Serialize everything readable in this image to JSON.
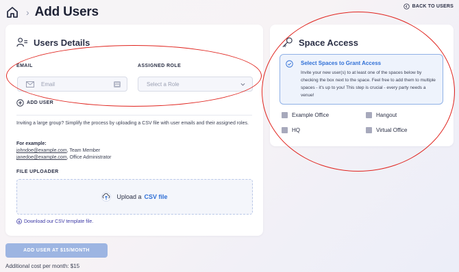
{
  "header": {
    "title": "Add Users",
    "back_label": "BACK TO USERS"
  },
  "users_card": {
    "title": "Users Details",
    "email_label": "EMAIL",
    "email_placeholder": "Email",
    "role_label": "ASSIGNED ROLE",
    "role_placeholder": "Select a Role",
    "add_user_label": "ADD USER",
    "bulk_text": "Inviting a large group? Simplify the process by uploading a CSV file with user emails and their assigned roles.",
    "example_title": "For example:",
    "examples": [
      {
        "email": "johndoe@example.com",
        "role": ", Team Member"
      },
      {
        "email": "janedoe@example.com",
        "role": ", Office Administrator"
      }
    ],
    "uploader_label": "FILE UPLOADER",
    "upload_text": "Upload a",
    "upload_link": "CSV file",
    "download_link": "Download our CSV template file."
  },
  "space_card": {
    "title": "Space Access",
    "notice_title": "Select Spaces to Grant Access",
    "notice_body": "Invite your new user(s) to at least one of the spaces below by checking the box next to the space. Feel free to add them to multiple spaces - it's up to you! This step is crucial - every party needs a venue!",
    "spaces": [
      "Example Office",
      "Hangout",
      "HQ",
      "Virtual Office"
    ]
  },
  "footer": {
    "submit_label": "ADD USER AT $15/MONTH",
    "cost_text": "Additional cost per month: $15"
  },
  "colors": {
    "accent": "#2f6fd6",
    "submit_bg": "#9db5e2",
    "annotation": "#e0221c"
  },
  "icons": [
    "home-icon",
    "back-arrow-icon",
    "user-list-icon",
    "key-icon",
    "mail-icon",
    "keypad-icon",
    "chevron-down-icon",
    "plus-circle-icon",
    "upload-icon",
    "download-icon",
    "check-circle-icon"
  ]
}
